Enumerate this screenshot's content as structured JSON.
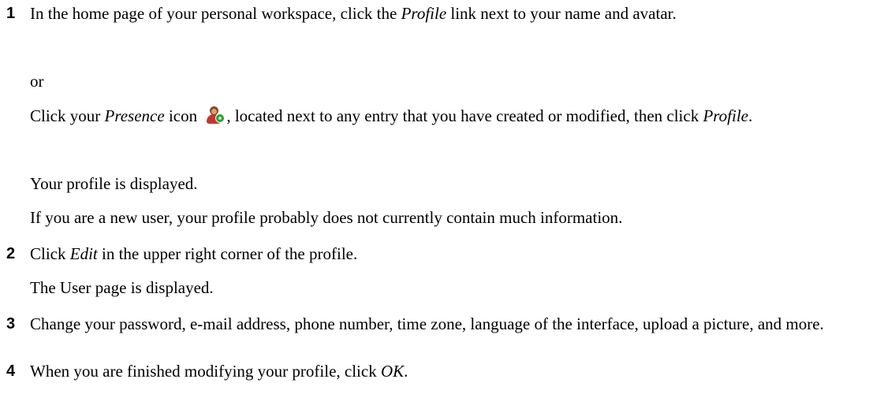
{
  "steps": [
    {
      "number": "1",
      "line1_pre": "In the home page of your personal workspace, click the ",
      "line1_link": "Profile",
      "line1_post": " link next to your name and avatar.",
      "or": "or",
      "click_pre": "Click your ",
      "click_presence": "Presence",
      "click_mid": " icon ",
      "click_post": ", located next to any entry that you have created or modified, then click ",
      "click_profile": "Profile",
      "click_end": ".",
      "result1": "Your profile is displayed.",
      "result2": "If you are a new user, your profile probably does not currently contain much information.",
      "icon": "presence-icon"
    },
    {
      "number": "2",
      "pre": "Click ",
      "link": "Edit",
      "post": " in the upper right corner of the profile.",
      "result": "The User page is displayed."
    },
    {
      "number": "3",
      "text": "Change your password, e-mail address, phone number, time zone, language of the interface, upload a picture, and more."
    },
    {
      "number": "4",
      "pre": "When you are finished modifying your profile, click ",
      "link": "OK",
      "post": "."
    }
  ]
}
